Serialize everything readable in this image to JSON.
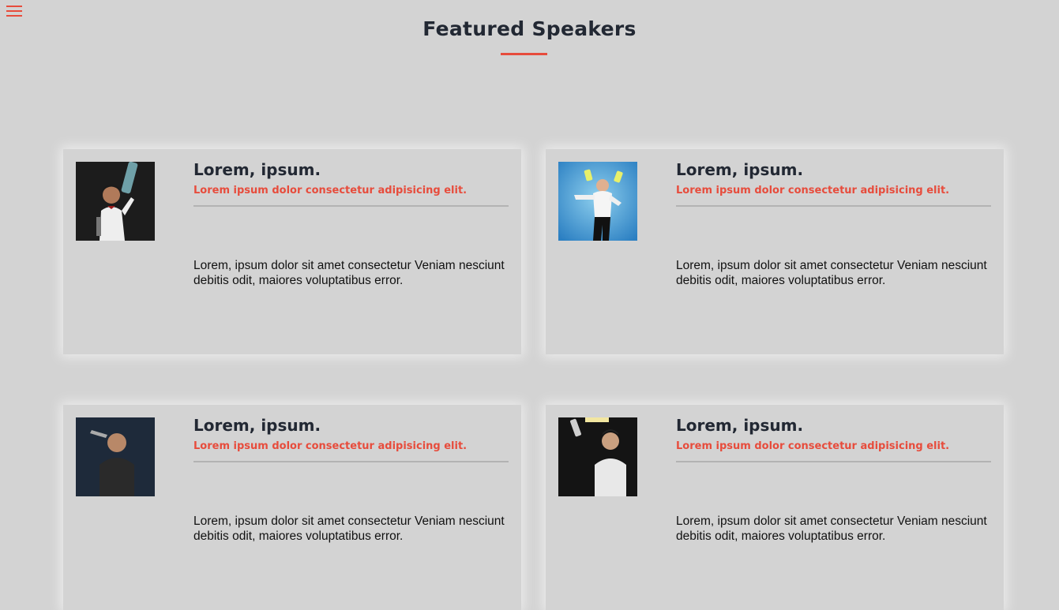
{
  "nav": {
    "menu_icon": "hamburger-menu-icon"
  },
  "section": {
    "title": "Featured Speakers"
  },
  "speakers": [
    {
      "name": "Lorem, ipsum.",
      "role": "Lorem ipsum dolor consectetur adipisicing elit.",
      "bio": "Lorem, ipsum dolor sit amet consectetur Veniam nesciunt debitis odit, maiores voluptatibus error."
    },
    {
      "name": "Lorem, ipsum.",
      "role": "Lorem ipsum dolor consectetur adipisicing elit.",
      "bio": "Lorem, ipsum dolor sit amet consectetur Veniam nesciunt debitis odit, maiores voluptatibus error."
    },
    {
      "name": "Lorem, ipsum.",
      "role": "Lorem ipsum dolor consectetur adipisicing elit.",
      "bio": "Lorem, ipsum dolor sit amet consectetur Veniam nesciunt debitis odit, maiores voluptatibus error."
    },
    {
      "name": "Lorem, ipsum.",
      "role": "Lorem ipsum dolor consectetur adipisicing elit.",
      "bio": "Lorem, ipsum dolor sit amet consectetur Veniam nesciunt debitis odit, maiores voluptatibus error."
    }
  ],
  "colors": {
    "accent": "#e74c3c",
    "background": "#d3d3d3",
    "heading": "#222833"
  }
}
